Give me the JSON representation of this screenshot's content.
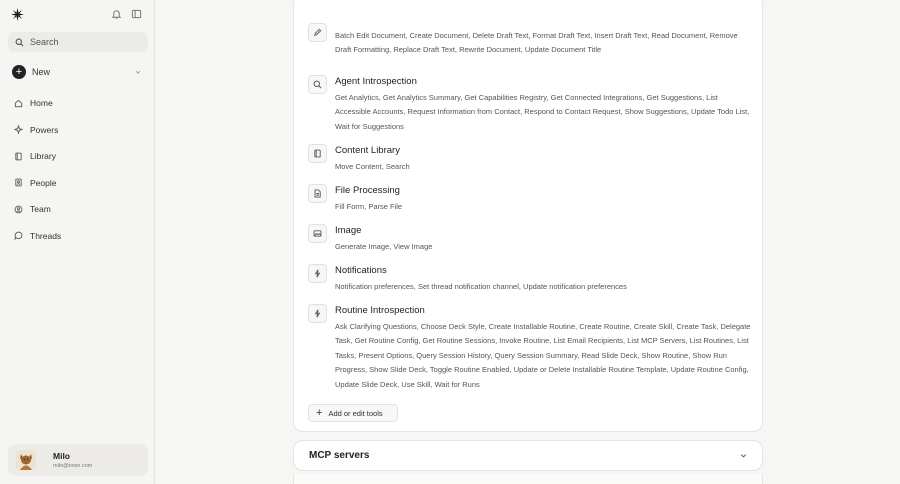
{
  "sidebar": {
    "search_label": "Search",
    "new_label": "New",
    "nav": [
      {
        "label": "Home",
        "icon": "home-icon"
      },
      {
        "label": "Powers",
        "icon": "powers-icon"
      },
      {
        "label": "Library",
        "icon": "library-icon"
      },
      {
        "label": "People",
        "icon": "people-icon"
      },
      {
        "label": "Team",
        "icon": "team-icon"
      },
      {
        "label": "Threads",
        "icon": "threads-icon"
      }
    ],
    "user": {
      "name": "Milo",
      "email": "milo@town.com"
    }
  },
  "tools": {
    "groups": [
      {
        "title": "",
        "icon": "pen-icon",
        "description": "Batch Edit Document, Create Document, Delete Draft Text, Format Draft Text, Insert Draft Text, Read Document, Remove Draft Formatting, Replace Draft Text, Rewrite Document, Update Document Title"
      },
      {
        "title": "Agent Introspection",
        "icon": "search-icon",
        "description": "Get Analytics, Get Analytics Summary, Get Capabilities Registry, Get Connected Integrations, Get Suggestions, List Accessible Accounts, Request Information from Contact, Respond to Contact Request, Show Suggestions, Update Todo List, Wait for Suggestions"
      },
      {
        "title": "Content Library",
        "icon": "book-icon",
        "description": "Move Content, Search"
      },
      {
        "title": "File Processing",
        "icon": "file-icon",
        "description": "Fill Form, Parse File"
      },
      {
        "title": "Image",
        "icon": "image-icon",
        "description": "Generate Image, View Image"
      },
      {
        "title": "Notifications",
        "icon": "bolt-icon",
        "description": "Notification preferences, Set thread notification channel, Update notification preferences"
      },
      {
        "title": "Routine Introspection",
        "icon": "bolt-icon",
        "description": "Ask Clarifying Questions, Choose Deck Style, Create Installable Routine, Create Routine, Create Skill, Create Task, Delegate Task, Get Routine Config, Get Routine Sessions, Invoke Routine, List Email Recipients, List MCP Servers, List Routines, List Tasks, Present Options, Query Session History, Query Session Summary, Read Slide Deck, Show Routine, Show Run Progress, Show Slide Deck, Toggle Routine Enabled, Update or Delete Installable Routine Template, Update Routine Config, Update Slide Deck, Use Skill, Wait for Runs"
      }
    ],
    "add_label": "Add or edit tools"
  },
  "mcp": {
    "title": "MCP servers"
  }
}
